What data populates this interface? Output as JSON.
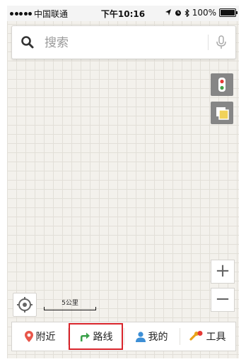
{
  "status_bar": {
    "carrier": "中国联通",
    "time": "下午10:16",
    "battery": "100%"
  },
  "search": {
    "placeholder": "搜索"
  },
  "map": {
    "scale_label": "5公里",
    "zoom_in": "+",
    "zoom_out": "−"
  },
  "tabs": [
    {
      "label": "附近",
      "icon": "location-pin-icon"
    },
    {
      "label": "路线",
      "icon": "route-arrow-icon"
    },
    {
      "label": "我的",
      "icon": "person-icon"
    },
    {
      "label": "工具",
      "icon": "tools-icon"
    }
  ],
  "colors": {
    "accent_red": "#d8232a",
    "route_green": "#3aa14a",
    "person_blue": "#3d8fd6"
  }
}
